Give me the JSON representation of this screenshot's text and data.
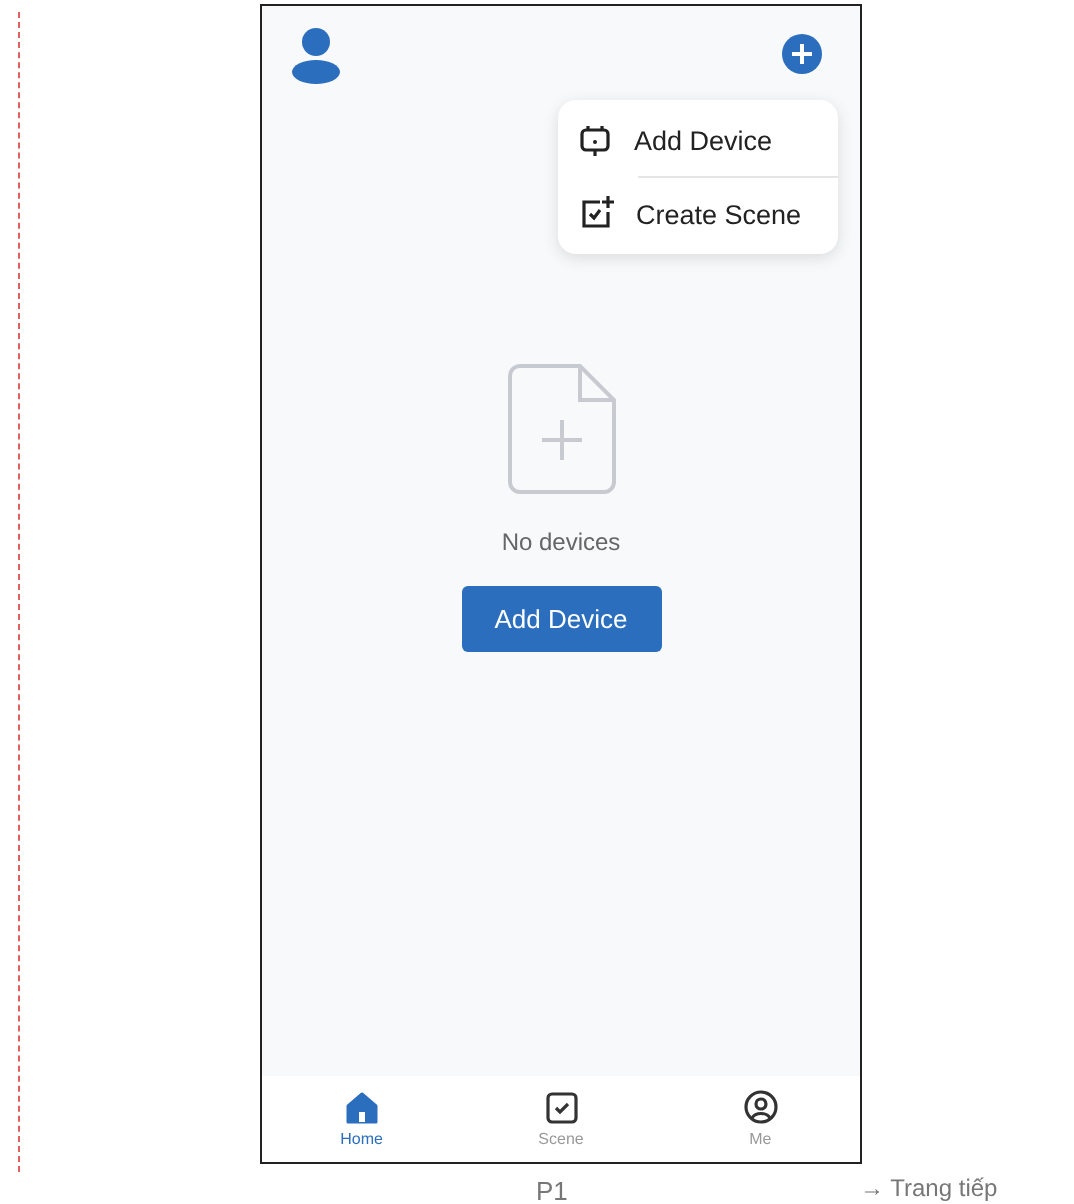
{
  "menu": {
    "items": [
      {
        "kind": "device",
        "label": "Add Device"
      },
      {
        "kind": "scene",
        "label": "Create Scene"
      }
    ]
  },
  "empty_state": {
    "message": "No devices",
    "button": "Add Device"
  },
  "bottom_nav": [
    {
      "kind": "home",
      "label": "Home",
      "selected": true
    },
    {
      "kind": "scene",
      "label": "Scene",
      "selected": false
    },
    {
      "kind": "me",
      "label": "Me",
      "selected": false
    }
  ],
  "caption": "P1",
  "next_link": "→ Trang tiếp"
}
